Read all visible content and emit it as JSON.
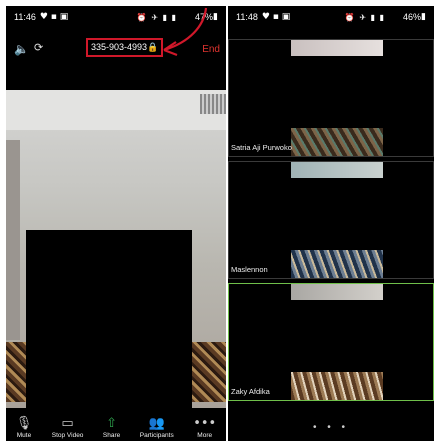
{
  "left_phone": {
    "status": {
      "time": "11:46",
      "battery": "47%",
      "indicators": "⏰ ✈ ⏏ 📶"
    },
    "meeting_id": "335-903-4993",
    "end_label": "End",
    "toolbar": [
      {
        "label": "Mute",
        "icon": "microphone-icon"
      },
      {
        "label": "Stop Video",
        "icon": "video-camera-icon"
      },
      {
        "label": "Share",
        "icon": "share-icon"
      },
      {
        "label": "Participants",
        "icon": "participants-icon"
      },
      {
        "label": "More",
        "icon": "more-icon"
      }
    ]
  },
  "right_phone": {
    "status": {
      "time": "11:48",
      "battery": "46%"
    },
    "participants": [
      "Satria Aji Purwoko",
      "Maslennon",
      "Zaky Afdika"
    ]
  },
  "colors": {
    "accent_red": "#d0182a",
    "active_border": "#6fbf4a",
    "share_green": "#2fa84f"
  }
}
